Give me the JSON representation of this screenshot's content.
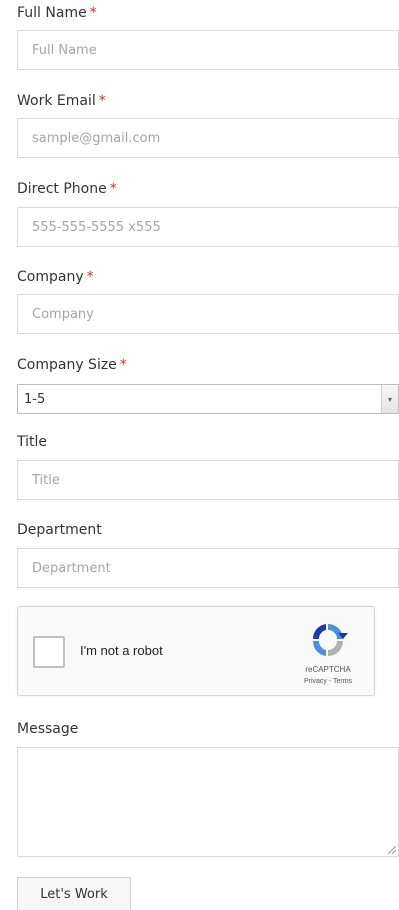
{
  "form": {
    "full_name": {
      "label": "Full Name",
      "required_mark": "*",
      "placeholder": "Full Name"
    },
    "work_email": {
      "label": "Work Email",
      "required_mark": "*",
      "placeholder": "sample@gmail.com"
    },
    "direct_phone": {
      "label": "Direct Phone",
      "required_mark": "*",
      "placeholder": "555-555-5555 x555"
    },
    "company": {
      "label": "Company",
      "required_mark": "*",
      "placeholder": "Company"
    },
    "company_size": {
      "label": "Company Size",
      "required_mark": "*",
      "selected": "1-5"
    },
    "title": {
      "label": "Title",
      "placeholder": "Title"
    },
    "department": {
      "label": "Department",
      "placeholder": "Department"
    },
    "recaptcha": {
      "checkbox_label": "I'm not a robot",
      "brand": "reCAPTCHA",
      "links": "Privacy - Terms"
    },
    "message": {
      "label": "Message"
    },
    "submit_label": "Let's Work"
  },
  "colors": {
    "required": "#c0392b",
    "border": "#d9d9d9",
    "placeholder": "#a5a5a5"
  },
  "icons": {
    "select_arrow": "chevron-down-icon",
    "captcha_logo": "recaptcha-logo-icon"
  }
}
